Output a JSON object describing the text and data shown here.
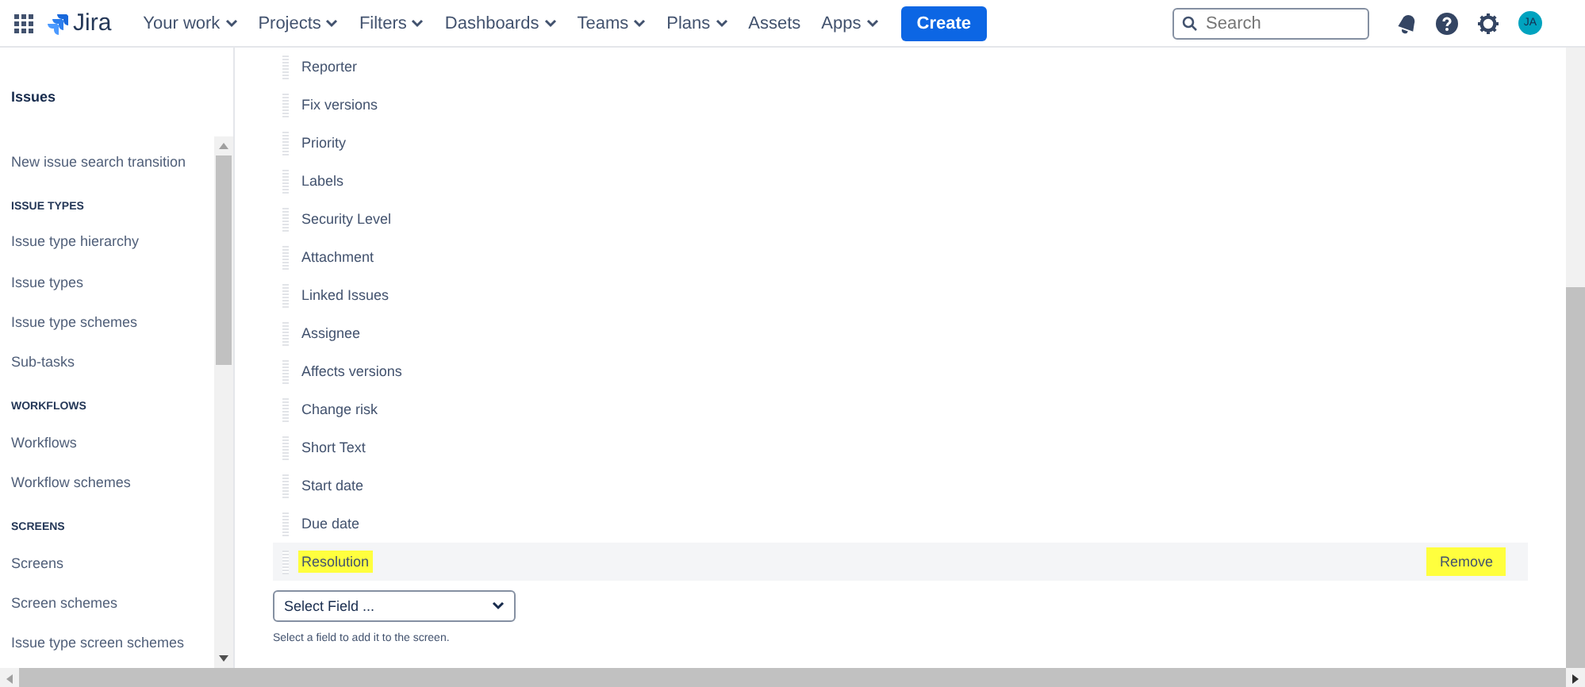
{
  "header": {
    "logo": "Jira",
    "nav": [
      {
        "label": "Your work",
        "dropdown": true
      },
      {
        "label": "Projects",
        "dropdown": true
      },
      {
        "label": "Filters",
        "dropdown": true
      },
      {
        "label": "Dashboards",
        "dropdown": true
      },
      {
        "label": "Teams",
        "dropdown": true
      },
      {
        "label": "Plans",
        "dropdown": true
      },
      {
        "label": "Assets",
        "dropdown": false
      },
      {
        "label": "Apps",
        "dropdown": true
      }
    ],
    "create": "Create",
    "search": {
      "placeholder": "Search"
    },
    "avatar": "JA"
  },
  "sidebar": {
    "title": "Issues",
    "items": [
      {
        "kind": "link",
        "label": "New issue search transition"
      },
      {
        "kind": "heading",
        "label": "ISSUE TYPES"
      },
      {
        "kind": "link",
        "label": "Issue type hierarchy"
      },
      {
        "kind": "link",
        "label": "Issue types"
      },
      {
        "kind": "link",
        "label": "Issue type schemes"
      },
      {
        "kind": "link",
        "label": "Sub-tasks"
      },
      {
        "kind": "heading",
        "label": "WORKFLOWS"
      },
      {
        "kind": "link",
        "label": "Workflows"
      },
      {
        "kind": "link",
        "label": "Workflow schemes"
      },
      {
        "kind": "heading",
        "label": "SCREENS"
      },
      {
        "kind": "link",
        "label": "Screens"
      },
      {
        "kind": "link",
        "label": "Screen schemes"
      },
      {
        "kind": "link",
        "label": "Issue type screen schemes"
      }
    ]
  },
  "fields": [
    {
      "label": "Reporter",
      "highlighted": false
    },
    {
      "label": "Fix versions",
      "highlighted": false
    },
    {
      "label": "Priority",
      "highlighted": false
    },
    {
      "label": "Labels",
      "highlighted": false
    },
    {
      "label": "Security Level",
      "highlighted": false
    },
    {
      "label": "Attachment",
      "highlighted": false
    },
    {
      "label": "Linked Issues",
      "highlighted": false
    },
    {
      "label": "Assignee",
      "highlighted": false
    },
    {
      "label": "Affects versions",
      "highlighted": false
    },
    {
      "label": "Change risk",
      "highlighted": false
    },
    {
      "label": "Short Text",
      "highlighted": false
    },
    {
      "label": "Start date",
      "highlighted": false
    },
    {
      "label": "Due date",
      "highlighted": false
    },
    {
      "label": "Resolution",
      "highlighted": true,
      "action": {
        "label": "Remove",
        "highlighted": true
      }
    }
  ],
  "select_field": {
    "value": "Select Field ...",
    "help": "Select a field to add it to the screen."
  }
}
